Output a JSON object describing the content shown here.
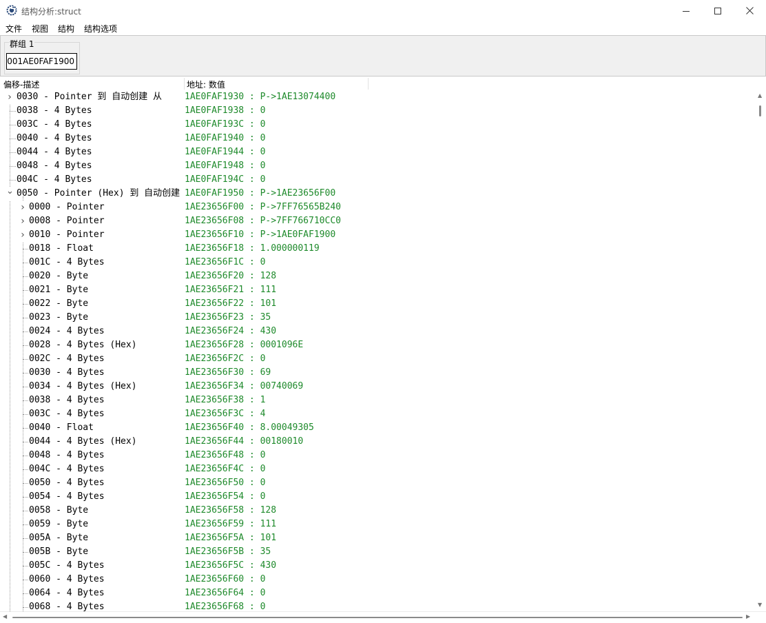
{
  "window": {
    "title": "结构分析:struct"
  },
  "menu": [
    "文件",
    "视图",
    "结构",
    "结构选项"
  ],
  "group": {
    "label": "群组 1",
    "address": "0001AE0FAF1900"
  },
  "columns": {
    "offset_desc": "偏移-描述",
    "address_value": "地址: 数值"
  },
  "rows": [
    {
      "level": 0,
      "expander": "collapsed",
      "desc": "0030 - Pointer 到 自动创建 从",
      "value": "1AE0FAF1930 : P->1AE13074400"
    },
    {
      "level": 0,
      "expander": "none",
      "desc": "0038 - 4 Bytes",
      "value": "1AE0FAF1938 : 0"
    },
    {
      "level": 0,
      "expander": "none",
      "desc": "003C - 4 Bytes",
      "value": "1AE0FAF193C : 0"
    },
    {
      "level": 0,
      "expander": "none",
      "desc": "0040 - 4 Bytes",
      "value": "1AE0FAF1940 : 0"
    },
    {
      "level": 0,
      "expander": "none",
      "desc": "0044 - 4 Bytes",
      "value": "1AE0FAF1944 : 0"
    },
    {
      "level": 0,
      "expander": "none",
      "desc": "0048 - 4 Bytes",
      "value": "1AE0FAF1948 : 0"
    },
    {
      "level": 0,
      "expander": "none",
      "desc": "004C - 4 Bytes",
      "value": "1AE0FAF194C : 0"
    },
    {
      "level": 0,
      "expander": "expanded",
      "desc": "0050 - Pointer (Hex) 到 自动创建",
      "value": "1AE0FAF1950 : P->1AE23656F00"
    },
    {
      "level": 1,
      "expander": "collapsed",
      "desc": "0000 - Pointer",
      "value": "1AE23656F00 : P->7FF76565B240"
    },
    {
      "level": 1,
      "expander": "collapsed",
      "desc": "0008 - Pointer",
      "value": "1AE23656F08 : P->7FF766710CC0"
    },
    {
      "level": 1,
      "expander": "collapsed",
      "desc": "0010 - Pointer",
      "value": "1AE23656F10 : P->1AE0FAF1900"
    },
    {
      "level": 1,
      "expander": "none",
      "desc": "0018 - Float",
      "value": "1AE23656F18 : 1.000000119"
    },
    {
      "level": 1,
      "expander": "none",
      "desc": "001C - 4 Bytes",
      "value": "1AE23656F1C : 0"
    },
    {
      "level": 1,
      "expander": "none",
      "desc": "0020 - Byte",
      "value": "1AE23656F20 : 128"
    },
    {
      "level": 1,
      "expander": "none",
      "desc": "0021 - Byte",
      "value": "1AE23656F21 : 111"
    },
    {
      "level": 1,
      "expander": "none",
      "desc": "0022 - Byte",
      "value": "1AE23656F22 : 101"
    },
    {
      "level": 1,
      "expander": "none",
      "desc": "0023 - Byte",
      "value": "1AE23656F23 : 35"
    },
    {
      "level": 1,
      "expander": "none",
      "desc": "0024 - 4 Bytes",
      "value": "1AE23656F24 : 430"
    },
    {
      "level": 1,
      "expander": "none",
      "desc": "0028 - 4 Bytes (Hex)",
      "value": "1AE23656F28 : 0001096E"
    },
    {
      "level": 1,
      "expander": "none",
      "desc": "002C - 4 Bytes",
      "value": "1AE23656F2C : 0"
    },
    {
      "level": 1,
      "expander": "none",
      "desc": "0030 - 4 Bytes",
      "value": "1AE23656F30 : 69"
    },
    {
      "level": 1,
      "expander": "none",
      "desc": "0034 - 4 Bytes (Hex)",
      "value": "1AE23656F34 : 00740069"
    },
    {
      "level": 1,
      "expander": "none",
      "desc": "0038 - 4 Bytes",
      "value": "1AE23656F38 : 1"
    },
    {
      "level": 1,
      "expander": "none",
      "desc": "003C - 4 Bytes",
      "value": "1AE23656F3C : 4"
    },
    {
      "level": 1,
      "expander": "none",
      "desc": "0040 - Float",
      "value": "1AE23656F40 : 8.00049305"
    },
    {
      "level": 1,
      "expander": "none",
      "desc": "0044 - 4 Bytes (Hex)",
      "value": "1AE23656F44 : 00180010"
    },
    {
      "level": 1,
      "expander": "none",
      "desc": "0048 - 4 Bytes",
      "value": "1AE23656F48 : 0"
    },
    {
      "level": 1,
      "expander": "none",
      "desc": "004C - 4 Bytes",
      "value": "1AE23656F4C : 0"
    },
    {
      "level": 1,
      "expander": "none",
      "desc": "0050 - 4 Bytes",
      "value": "1AE23656F50 : 0"
    },
    {
      "level": 1,
      "expander": "none",
      "desc": "0054 - 4 Bytes",
      "value": "1AE23656F54 : 0"
    },
    {
      "level": 1,
      "expander": "none",
      "desc": "0058 - Byte",
      "value": "1AE23656F58 : 128"
    },
    {
      "level": 1,
      "expander": "none",
      "desc": "0059 - Byte",
      "value": "1AE23656F59 : 111"
    },
    {
      "level": 1,
      "expander": "none",
      "desc": "005A - Byte",
      "value": "1AE23656F5A : 101"
    },
    {
      "level": 1,
      "expander": "none",
      "desc": "005B - Byte",
      "value": "1AE23656F5B : 35"
    },
    {
      "level": 1,
      "expander": "none",
      "desc": "005C - 4 Bytes",
      "value": "1AE23656F5C : 430"
    },
    {
      "level": 1,
      "expander": "none",
      "desc": "0060 - 4 Bytes",
      "value": "1AE23656F60 : 0"
    },
    {
      "level": 1,
      "expander": "none",
      "desc": "0064 - 4 Bytes",
      "value": "1AE23656F64 : 0"
    },
    {
      "level": 1,
      "expander": "none",
      "desc": "0068 - 4 Bytes",
      "value": "1AE23656F68 : 0"
    }
  ],
  "colors": {
    "value_text": "#1e8a2b",
    "tree_lines": "#9a9a9a",
    "panel_bg": "#f0f0f0"
  },
  "icons": {
    "app": "cheat-engine-gear-icon",
    "minimize": "minimize-icon",
    "maximize": "maximize-icon",
    "close": "close-icon"
  }
}
